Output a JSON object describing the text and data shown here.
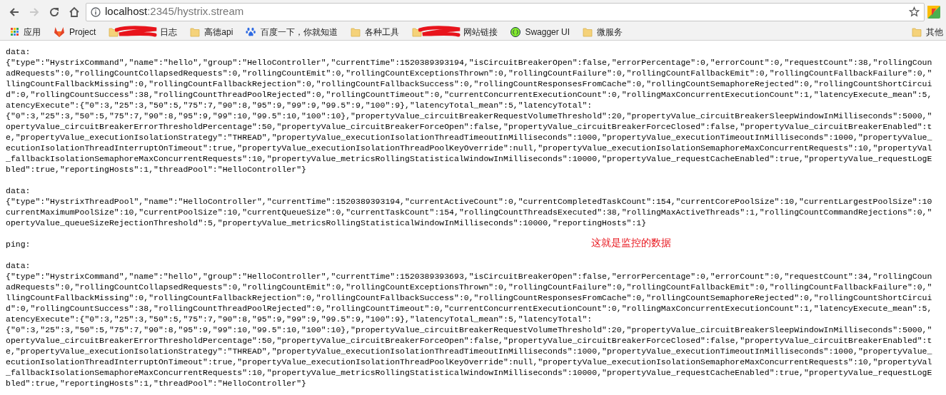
{
  "toolbar": {
    "back_disabled": false,
    "forward_disabled": true,
    "url_host": "localhost",
    "url_rest": ":2345/hystrix.stream"
  },
  "bookmarks": [
    {
      "kind": "apps",
      "label": "应用",
      "redacted": false
    },
    {
      "kind": "fox",
      "label": "Project",
      "redacted": false
    },
    {
      "kind": "folder",
      "label": "日志",
      "redacted": true
    },
    {
      "kind": "folder",
      "label": "高德api",
      "redacted": false
    },
    {
      "kind": "paw",
      "label": "百度一下，你就知道",
      "redacted": false
    },
    {
      "kind": "folder",
      "label": "各种工具",
      "redacted": false
    },
    {
      "kind": "folder",
      "label": "网站链接",
      "redacted": true
    },
    {
      "kind": "swagger",
      "label": "Swagger UI",
      "redacted": false
    },
    {
      "kind": "folder",
      "label": "微服务",
      "redacted": false
    }
  ],
  "other_bookmarks": {
    "label": "其他"
  },
  "annotation": "这就是监控的数据",
  "stream": [
    {
      "kind": "text",
      "text": "data:"
    },
    {
      "kind": "text",
      "text": "{\"type\":\"HystrixCommand\",\"name\":\"hello\",\"group\":\"HelloController\",\"currentTime\":1520389393194,\"isCircuitBreakerOpen\":false,\"errorPercentage\":0,\"errorCount\":0,\"requestCount\":38,\"rollingCoun"
    },
    {
      "kind": "text",
      "text": "adRequests\":0,\"rollingCountCollapsedRequests\":0,\"rollingCountEmit\":0,\"rollingCountExceptionsThrown\":0,\"rollingCountFailure\":0,\"rollingCountFallbackEmit\":0,\"rollingCountFallbackFailure\":0,\""
    },
    {
      "kind": "text",
      "text": "llingCountFallbackMissing\":0,\"rollingCountFallbackRejection\":0,\"rollingCountFallbackSuccess\":0,\"rollingCountResponsesFromCache\":0,\"rollingCountSemaphoreRejected\":0,\"rollingCountShortCircui"
    },
    {
      "kind": "text",
      "text": "d\":0,\"rollingCountSuccess\":38,\"rollingCountThreadPoolRejected\":0,\"rollingCountTimeout\":0,\"currentConcurrentExecutionCount\":0,\"rollingMaxConcurrentExecutionCount\":1,\"latencyExecute_mean\":5,"
    },
    {
      "kind": "text",
      "text": "atencyExecute\":{\"0\":3,\"25\":3,\"50\":5,\"75\":7,\"90\":8,\"95\":9,\"99\":9,\"99.5\":9,\"100\":9},\"latencyTotal_mean\":5,\"latencyTotal\":"
    },
    {
      "kind": "text",
      "text": "{\"0\":3,\"25\":3,\"50\":5,\"75\":7,\"90\":8,\"95\":9,\"99\":10,\"99.5\":10,\"100\":10},\"propertyValue_circuitBreakerRequestVolumeThreshold\":20,\"propertyValue_circuitBreakerSleepWindowInMilliseconds\":5000,\""
    },
    {
      "kind": "text",
      "text": "opertyValue_circuitBreakerErrorThresholdPercentage\":50,\"propertyValue_circuitBreakerForceOpen\":false,\"propertyValue_circuitBreakerForceClosed\":false,\"propertyValue_circuitBreakerEnabled\":t"
    },
    {
      "kind": "text",
      "text": "e,\"propertyValue_executionIsolationStrategy\":\"THREAD\",\"propertyValue_executionIsolationThreadTimeoutInMilliseconds\":1000,\"propertyValue_executionTimeoutInMilliseconds\":1000,\"propertyValue_"
    },
    {
      "kind": "text",
      "text": "ecutionIsolationThreadInterruptOnTimeout\":true,\"propertyValue_executionIsolationThreadPoolKeyOverride\":null,\"propertyValue_executionIsolationSemaphoreMaxConcurrentRequests\":10,\"propertyVal"
    },
    {
      "kind": "text",
      "text": "_fallbackIsolationSemaphoreMaxConcurrentRequests\":10,\"propertyValue_metricsRollingStatisticalWindowInMilliseconds\":10000,\"propertyValue_requestCacheEnabled\":true,\"propertyValue_requestLogE"
    },
    {
      "kind": "text",
      "text": "bled\":true,\"reportingHosts\":1,\"threadPool\":\"HelloController\"}"
    },
    {
      "kind": "gap"
    },
    {
      "kind": "text",
      "text": "data:"
    },
    {
      "kind": "text",
      "text": "{\"type\":\"HystrixThreadPool\",\"name\":\"HelloController\",\"currentTime\":1520389393194,\"currentActiveCount\":0,\"currentCompletedTaskCount\":154,\"currentCorePoolSize\":10,\"currentLargestPoolSize\":10"
    },
    {
      "kind": "text",
      "text": "currentMaximumPoolSize\":10,\"currentPoolSize\":10,\"currentQueueSize\":0,\"currentTaskCount\":154,\"rollingCountThreadsExecuted\":38,\"rollingMaxActiveThreads\":1,\"rollingCountCommandRejections\":0,\""
    },
    {
      "kind": "text",
      "text": "opertyValue_queueSizeRejectionThreshold\":5,\"propertyValue_metricsRollingStatisticalWindowInMilliseconds\":10000,\"reportingHosts\":1}"
    },
    {
      "kind": "gap"
    },
    {
      "kind": "text",
      "text": "ping:"
    },
    {
      "kind": "gap"
    },
    {
      "kind": "text",
      "text": "data:"
    },
    {
      "kind": "text",
      "text": "{\"type\":\"HystrixCommand\",\"name\":\"hello\",\"group\":\"HelloController\",\"currentTime\":1520389393693,\"isCircuitBreakerOpen\":false,\"errorPercentage\":0,\"errorCount\":0,\"requestCount\":34,\"rollingCoun"
    },
    {
      "kind": "text",
      "text": "adRequests\":0,\"rollingCountCollapsedRequests\":0,\"rollingCountEmit\":0,\"rollingCountExceptionsThrown\":0,\"rollingCountFailure\":0,\"rollingCountFallbackEmit\":0,\"rollingCountFallbackFailure\":0,\""
    },
    {
      "kind": "text",
      "text": "llingCountFallbackMissing\":0,\"rollingCountFallbackRejection\":0,\"rollingCountFallbackSuccess\":0,\"rollingCountResponsesFromCache\":0,\"rollingCountSemaphoreRejected\":0,\"rollingCountShortCircui"
    },
    {
      "kind": "text",
      "text": "d\":0,\"rollingCountSuccess\":38,\"rollingCountThreadPoolRejected\":0,\"rollingCountTimeout\":0,\"currentConcurrentExecutionCount\":0,\"rollingMaxConcurrentExecutionCount\":1,\"latencyExecute_mean\":5,"
    },
    {
      "kind": "text",
      "text": "atencyExecute\":{\"0\":3,\"25\":3,\"50\":5,\"75\":7,\"90\":8,\"95\":9,\"99\":9,\"99.5\":9,\"100\":9},\"latencyTotal_mean\":5,\"latencyTotal\":"
    },
    {
      "kind": "text",
      "text": "{\"0\":3,\"25\":3,\"50\":5,\"75\":7,\"90\":8,\"95\":9,\"99\":10,\"99.5\":10,\"100\":10},\"propertyValue_circuitBreakerRequestVolumeThreshold\":20,\"propertyValue_circuitBreakerSleepWindowInMilliseconds\":5000,\""
    },
    {
      "kind": "text",
      "text": "opertyValue_circuitBreakerErrorThresholdPercentage\":50,\"propertyValue_circuitBreakerForceOpen\":false,\"propertyValue_circuitBreakerForceClosed\":false,\"propertyValue_circuitBreakerEnabled\":t"
    },
    {
      "kind": "text",
      "text": "e,\"propertyValue_executionIsolationStrategy\":\"THREAD\",\"propertyValue_executionIsolationThreadTimeoutInMilliseconds\":1000,\"propertyValue_executionTimeoutInMilliseconds\":1000,\"propertyValue_"
    },
    {
      "kind": "text",
      "text": "ecutionIsolationThreadInterruptOnTimeout\":true,\"propertyValue_executionIsolationThreadPoolKeyOverride\":null,\"propertyValue_executionIsolationSemaphoreMaxConcurrentRequests\":10,\"propertyVal"
    },
    {
      "kind": "text",
      "text": "_fallbackIsolationSemaphoreMaxConcurrentRequests\":10,\"propertyValue_metricsRollingStatisticalWindowInMilliseconds\":10000,\"propertyValue_requestCacheEnabled\":true,\"propertyValue_requestLogE"
    },
    {
      "kind": "text",
      "text": "bled\":true,\"reportingHosts\":1,\"threadPool\":\"HelloController\"}"
    }
  ]
}
